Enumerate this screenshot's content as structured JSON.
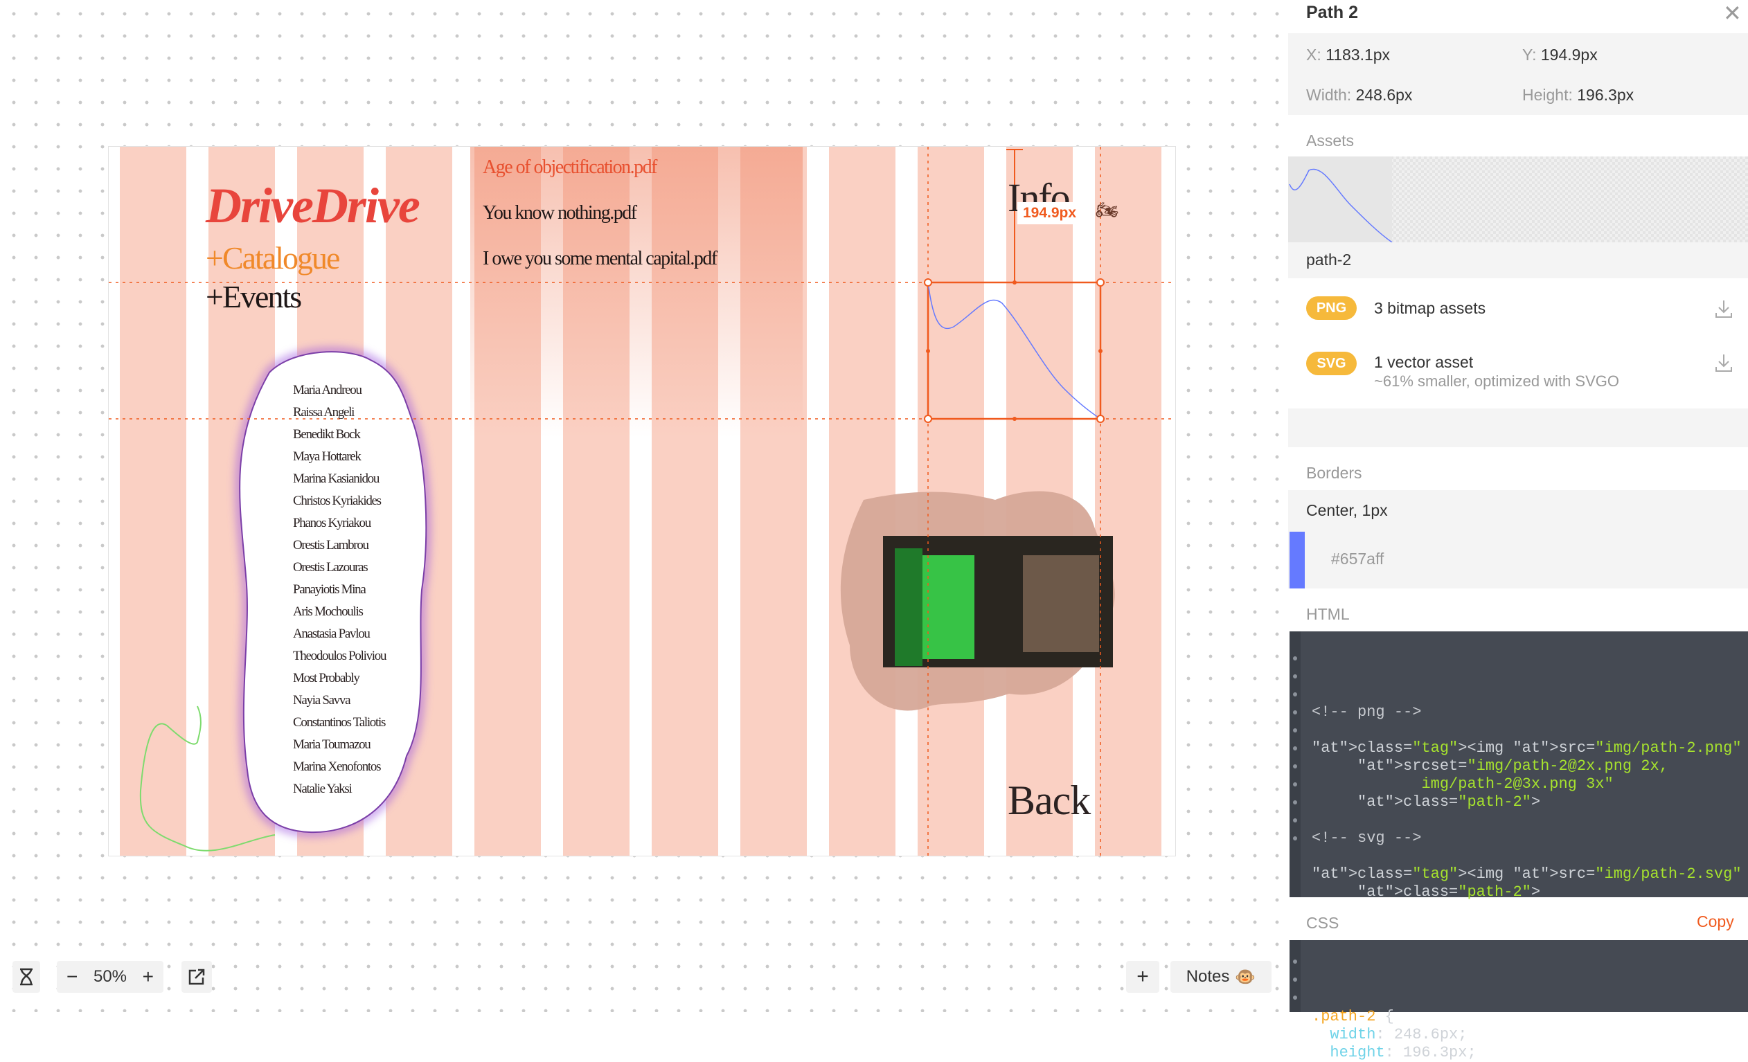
{
  "artboard": {
    "brand": "DriveDrive",
    "nav": {
      "catalogue": "+Catalogue",
      "events": "+Events"
    },
    "files": [
      "Age of objectification.pdf",
      "You know nothing.pdf",
      "I owe you some mental capital.pdf"
    ],
    "info": "Info",
    "back": "Back",
    "measure_label": "194.9px",
    "names": [
      "Maria Andreou",
      "Raissa Angeli",
      "Benedikt Bock",
      "Maya Hottarek",
      "Marina Kasianidou",
      "Christos Kyriakides",
      "Phanos Kyriakou",
      "Orestis Lambrou",
      "Orestis Lazouras",
      "Panayiotis Mina",
      "Aris Mochoulis",
      "Anastasia Pavlou",
      "Theodoulos Poliviou",
      "Most Probably",
      "Nayia Savva",
      "Constantinos Taliotis",
      "Maria Toumazou",
      "Marina Xenofontos",
      "Natalie Yaksi"
    ],
    "colors": {
      "brand": "#e8453c",
      "catalogue": "#f0892a",
      "file_highlight": "#e8502f",
      "selection": "#f05a1e",
      "path_stroke": "#657aff",
      "blob_glow": "#9b5de5"
    }
  },
  "toolbar": {
    "history_icon": "hourglass-icon",
    "zoom_out": "−",
    "zoom_level": "50%",
    "zoom_in": "+",
    "export_icon": "external-link-icon",
    "add": "+",
    "notes": "Notes",
    "notes_emoji": "🐵"
  },
  "panel": {
    "title": "Path 2",
    "close_icon": "close-icon",
    "x_label": "X:",
    "x_value": "1183.1px",
    "y_label": "Y:",
    "y_value": "194.9px",
    "w_label": "Width:",
    "w_value": "248.6px",
    "h_label": "Height:",
    "h_value": "196.3px",
    "assets_heading": "Assets",
    "asset_name": "path-2",
    "png_badge": "PNG",
    "png_text": "3 bitmap assets",
    "svg_badge": "SVG",
    "svg_text": "1 vector asset",
    "svg_sub": "~61% smaller, optimized with SVGO",
    "download_icon": "download-icon",
    "borders_heading": "Borders",
    "border_desc": "Center, 1px",
    "border_color": "#657aff",
    "html_heading": "HTML",
    "html_code": [
      "<!-- png -->",
      "",
      "<img src=\"img/path-2.png\"",
      "     srcset=\"img/path-2@2x.png 2x,",
      "            img/path-2@3x.png 3x\"",
      "     class=\"path-2\">",
      "",
      "<!-- svg -->",
      "",
      "<img src=\"img/path-2.svg\"",
      "     class=\"path-2\">"
    ],
    "css_heading": "CSS",
    "copy_label": "Copy",
    "css_code": [
      ".path-2 {",
      "  width: 248.6px;",
      "  height: 196.3px;"
    ]
  }
}
